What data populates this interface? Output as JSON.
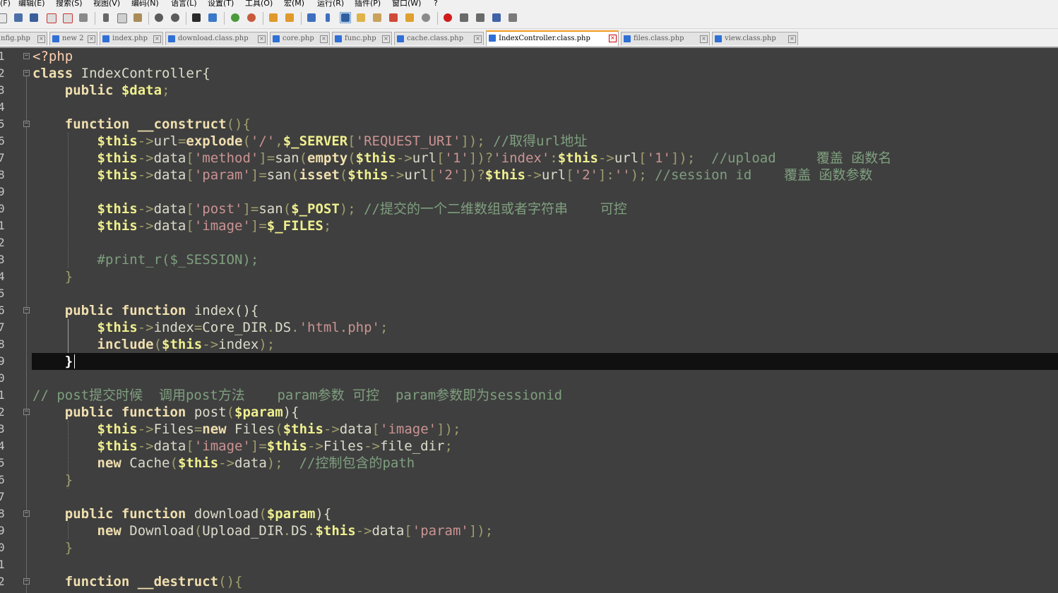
{
  "menu": [
    "(F)",
    "编辑(E)",
    "搜索(S)",
    "视图(V)",
    "编码(N)",
    "语言(L)",
    "设置(T)",
    "工具(O)",
    "宏(M)",
    "运行(R)",
    "插件(P)",
    "窗口(W)",
    "?"
  ],
  "tabs": [
    {
      "label": "nfig.php",
      "active": false
    },
    {
      "label": "new 2",
      "active": false
    },
    {
      "label": "index.php",
      "active": false
    },
    {
      "label": "download.class.php",
      "active": false
    },
    {
      "label": "core.php",
      "active": false
    },
    {
      "label": "func.php",
      "active": false
    },
    {
      "label": "cache.class.php",
      "active": false
    },
    {
      "label": "IndexController.class.php",
      "active": true
    },
    {
      "label": "files.class.php",
      "active": false
    },
    {
      "label": "view.class.php",
      "active": false
    }
  ],
  "tab_close_glyph": "×",
  "line_numbers": [
    "1",
    "2",
    "3",
    "4",
    "5",
    "6",
    "7",
    "8",
    "9",
    "0",
    "1",
    "2",
    "3",
    "4",
    "5",
    "6",
    "7",
    "8",
    "9",
    "0",
    "1",
    "2",
    "3",
    "4",
    "5",
    "6",
    "7",
    "8",
    "9",
    "0",
    "1",
    "2"
  ],
  "fold_marker": "−",
  "code": {
    "l1": [
      "<?php"
    ],
    "l2": [
      "class",
      " IndexController{"
    ],
    "l3": [
      "    ",
      "public",
      " ",
      "$data",
      ";"
    ],
    "l5": [
      "    ",
      "function",
      " ",
      "__construct",
      "(){"
    ],
    "l6": [
      "        ",
      "$this",
      "->",
      "url",
      "=",
      "explode",
      "(",
      "'/'",
      ",",
      "$_SERVER",
      "[",
      "'REQUEST_URI'",
      "]);",
      " //取得url地址"
    ],
    "l7": [
      "        ",
      "$this",
      "->",
      "data",
      "[",
      "'method'",
      "]=",
      "san",
      "(",
      "empty",
      "(",
      "$this",
      "->",
      "url",
      "[",
      "'1'",
      "])?",
      "'index'",
      ":",
      "$this",
      "->",
      "url",
      "[",
      "'1'",
      "]);",
      "  //upload     覆盖 函数名"
    ],
    "l8": [
      "        ",
      "$this",
      "->",
      "data",
      "[",
      "'param'",
      "]=",
      "san",
      "(",
      "isset",
      "(",
      "$this",
      "->",
      "url",
      "[",
      "'2'",
      "])?",
      "$this",
      "->",
      "url",
      "[",
      "'2'",
      "]:",
      "''",
      ");",
      " //session id    覆盖 函数参数"
    ],
    "l10": [
      "        ",
      "$this",
      "->",
      "data",
      "[",
      "'post'",
      "]=",
      "san",
      "(",
      "$_POST",
      ");",
      " //提交的一个二维数组或者字符串    可控"
    ],
    "l11": [
      "        ",
      "$this",
      "->",
      "data",
      "[",
      "'image'",
      "]=",
      "$_FILES",
      ";"
    ],
    "l13": [
      "        ",
      "#print_r($_SESSION);"
    ],
    "l14": [
      "    ",
      "}"
    ],
    "l16": [
      "    ",
      "public",
      " ",
      "function",
      " index",
      "(){"
    ],
    "l17": [
      "        ",
      "$this",
      "->",
      "index",
      "=",
      "Core_DIR",
      ".",
      "DS",
      ".",
      "'html.php'",
      ";"
    ],
    "l18": [
      "        ",
      "include",
      "(",
      "$this",
      "->",
      "index",
      ");"
    ],
    "l19": [
      "    ",
      "}"
    ],
    "l21": [
      "// post提交时候  调用post方法    param参数 可控  param参数即为sessionid"
    ],
    "l22": [
      "    ",
      "public",
      " ",
      "function",
      " post",
      "(",
      "$param",
      "){"
    ],
    "l23": [
      "        ",
      "$this",
      "->",
      "Files",
      "=",
      "new",
      " Files",
      "(",
      "$this",
      "->",
      "data",
      "[",
      "'image'",
      "]);"
    ],
    "l24": [
      "        ",
      "$this",
      "->",
      "data",
      "[",
      "'image'",
      "]=",
      "$this",
      "->",
      "Files",
      "->",
      "file_dir",
      ";"
    ],
    "l25": [
      "        ",
      "new",
      " Cache",
      "(",
      "$this",
      "->",
      "data",
      ");",
      "  //控制包含的path"
    ],
    "l26": [
      "    ",
      "}"
    ],
    "l28": [
      "    ",
      "public",
      " ",
      "function",
      " download",
      "(",
      "$param",
      "){"
    ],
    "l29": [
      "        ",
      "new",
      " Download",
      "(",
      "Upload_DIR",
      ".",
      "DS",
      ".",
      "$this",
      "->",
      "data",
      "[",
      "'param'",
      "]);"
    ],
    "l30": [
      "    ",
      "}"
    ],
    "l32": [
      "    ",
      "function",
      " ",
      "__destruct",
      "(){"
    ]
  }
}
